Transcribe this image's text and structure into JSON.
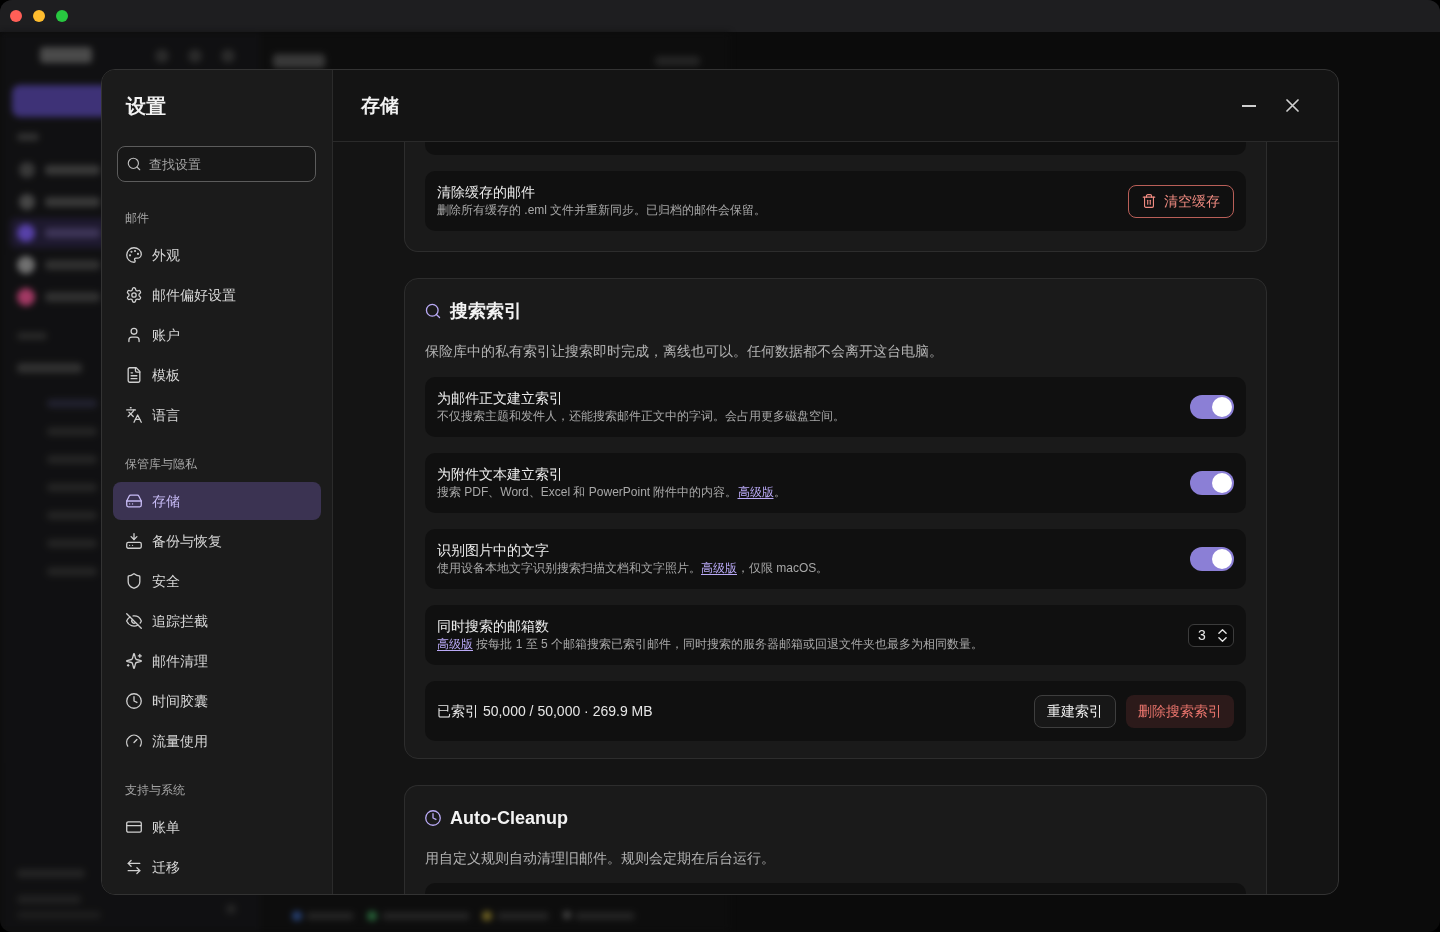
{
  "sidebar": {
    "title": "设置",
    "search": {
      "placeholder": "查找设置"
    },
    "sections": [
      {
        "label": "邮件",
        "items": [
          {
            "label": "外观",
            "selected": false
          },
          {
            "label": "邮件偏好设置",
            "selected": false
          },
          {
            "label": "账户",
            "selected": false
          },
          {
            "label": "模板",
            "selected": false
          },
          {
            "label": "语言",
            "selected": false
          }
        ]
      },
      {
        "label": "保管库与隐私",
        "items": [
          {
            "label": "存储",
            "selected": true
          },
          {
            "label": "备份与恢复",
            "selected": false
          },
          {
            "label": "安全",
            "selected": false
          },
          {
            "label": "追踪拦截",
            "selected": false
          },
          {
            "label": "邮件清理",
            "selected": false
          },
          {
            "label": "时间胶囊",
            "selected": false
          },
          {
            "label": "流量使用",
            "selected": false
          }
        ]
      },
      {
        "label": "支持与系统",
        "items": [
          {
            "label": "账单",
            "selected": false
          },
          {
            "label": "迁移",
            "selected": false
          }
        ]
      }
    ]
  },
  "panel": {
    "title": "存储",
    "cards": [
      {
        "kind": "cut_top",
        "rows": [
          {
            "kind": "clipped"
          },
          {
            "kind": "action",
            "title": "清除缓存的邮件",
            "description": [
              {
                "kind": "text",
                "text": "删除所有缓存的 .eml 文件并重新同步。已归档的邮件会保留。"
              }
            ],
            "button": {
              "kind": "danger_outline",
              "label": "清空缓存"
            }
          }
        ]
      },
      {
        "kind": "full",
        "title": "搜索索引",
        "description": "保险库中的私有索引让搜索即时完成，离线也可以。任何数据都不会离开这台电脑。",
        "rows": [
          {
            "kind": "toggle",
            "title": "为邮件正文建立索引",
            "description": [
              {
                "kind": "text",
                "text": "不仅搜索主题和发件人，还能搜索邮件正文中的字词。会占用更多磁盘空间。"
              }
            ],
            "on": true
          },
          {
            "kind": "toggle",
            "title": "为附件文本建立索引",
            "description": [
              {
                "kind": "text",
                "text": "搜索 PDF、Word、Excel 和 PowerPoint 附件中的内容。"
              },
              {
                "kind": "link",
                "text": "高级版"
              },
              {
                "kind": "text",
                "text": "。"
              }
            ],
            "on": true
          },
          {
            "kind": "toggle",
            "title": "识别图片中的文字",
            "description": [
              {
                "kind": "text",
                "text": "使用设备本地文字识别搜索扫描文档和文字照片。"
              },
              {
                "kind": "link",
                "text": "高级版"
              },
              {
                "kind": "text",
                "text": "，仅限 macOS。"
              }
            ],
            "on": true
          },
          {
            "kind": "stepper",
            "title": "同时搜索的邮箱数",
            "description": [
              {
                "kind": "link",
                "text": "高级版"
              },
              {
                "kind": "text",
                "text": " 按每批 1 至 5 个邮箱搜索已索引邮件，同时搜索的服务器邮箱或回退文件夹也最多为相同数量。"
              }
            ],
            "value": "3"
          },
          {
            "kind": "status",
            "text": "已索引 50,000 / 50,000 · 269.9 MB",
            "buttons": [
              {
                "kind": "secondary",
                "label": "重建索引"
              },
              {
                "kind": "danger",
                "label": "删除搜索索引"
              }
            ]
          }
        ]
      },
      {
        "kind": "cut_bottom",
        "title": "Auto-Cleanup",
        "description": "用自定义规则自动清理旧邮件。规则会定期在后台运行。",
        "rows": [
          {
            "kind": "clipped"
          }
        ]
      }
    ]
  }
}
